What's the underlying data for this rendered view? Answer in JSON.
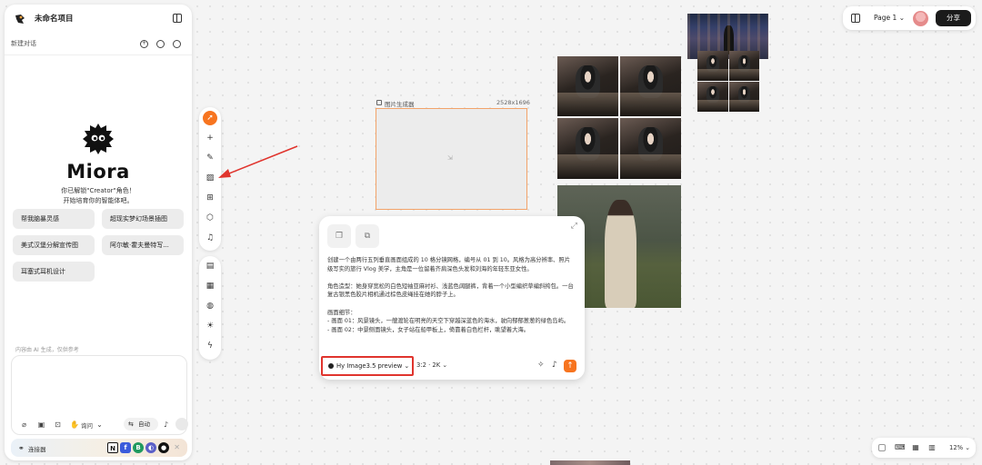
{
  "project": {
    "title": "未命名项目"
  },
  "conversation": {
    "new_label": "新建对话"
  },
  "brand": {
    "name": "Miora",
    "greeting_line1": "你已解锁\"Creator\"角色！",
    "greeting_line2": "开始培育你的智能体吧。"
  },
  "suggestions": [
    {
      "label": "帮我脑暴灵感"
    },
    {
      "label": "超现实梦幻场景插图"
    },
    {
      "label": "美式汉堡分解宣传图"
    },
    {
      "label": "阿尔敏·霍夫曼特写..."
    },
    {
      "label": "耳塞式耳机设计"
    }
  ],
  "composer": {
    "disclaimer": "内容由 AI 生成，仅供参考",
    "think_label": "询问",
    "auto_label": "自动"
  },
  "connectors": {
    "label": "连接器",
    "apps": [
      "notion",
      "figma",
      "b-app",
      "linear",
      "github"
    ]
  },
  "frame": {
    "label": "图片生成器",
    "size": "2528x1696"
  },
  "prompt": {
    "text": "创建一个由两行五列垂直画面组成的 10 格分镜网格，编号从 01 到 10。风格为高分辨率、照片级写实的旅行 Vlog 美学，主角是一位留着齐肩深色头发和刘海的年轻东亚女性。\n\n角色造型：她身穿宽松的白色短袖亚麻衬衫、浅蓝色阔腿裤，背着一个小型编织草编斜挎包。一台复古银黑色胶片相机通过棕色皮绳挂在她的脖子上。\n\n画面细节：\n- 画面 01：风景镜头，一艘渡轮在明亮的天空下穿越深蓝色的海水，驶向郁郁葱葱的绿色岛屿。\n- 画面 02：中景侧面镜头，女子站在船甲板上，倚靠着白色栏杆，眺望着大海。",
    "model": "Hy Image3.5 preview",
    "ratio": "3:2 · 2K"
  },
  "topbar": {
    "page_label": "Page 1",
    "share_label": "分享"
  },
  "zoom": {
    "level": "12%"
  },
  "colors": {
    "accent": "#f7741f",
    "highlight_box": "#e0342d",
    "frame_border": "#f2a36a"
  }
}
